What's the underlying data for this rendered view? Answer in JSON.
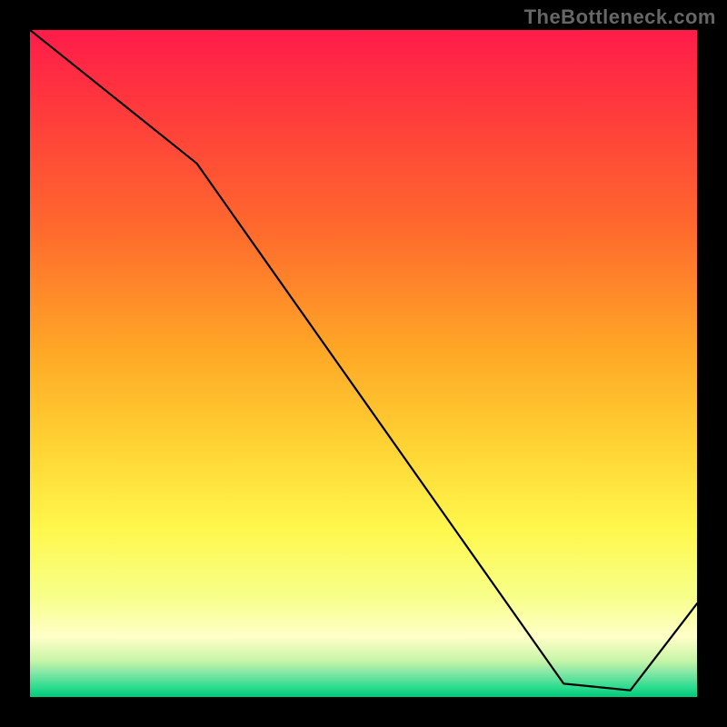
{
  "watermark": "TheBottleneck.com",
  "floor_label": "",
  "colors": {
    "frame": "#000000",
    "line": "#000000",
    "label": "#D22B2B",
    "watermark": "#666666"
  },
  "chart_data": {
    "type": "line",
    "title": "",
    "xlabel": "",
    "ylabel": "",
    "xlim": [
      0,
      100
    ],
    "ylim": [
      0,
      100
    ],
    "background_gradient_stops": [
      {
        "pos": 0.0,
        "color": "#FF1C4A"
      },
      {
        "pos": 0.12,
        "color": "#FF3A3C"
      },
      {
        "pos": 0.3,
        "color": "#FF6A2D"
      },
      {
        "pos": 0.48,
        "color": "#FFA726"
      },
      {
        "pos": 0.62,
        "color": "#FFD233"
      },
      {
        "pos": 0.75,
        "color": "#FFF84D"
      },
      {
        "pos": 0.85,
        "color": "#F7FF8A"
      },
      {
        "pos": 0.91,
        "color": "#FFFFC8"
      },
      {
        "pos": 0.945,
        "color": "#C8F5A8"
      },
      {
        "pos": 0.965,
        "color": "#7FE6A5"
      },
      {
        "pos": 0.985,
        "color": "#2DDC8F"
      },
      {
        "pos": 1.0,
        "color": "#00C97A"
      }
    ],
    "series": [
      {
        "name": "bottleneck-curve",
        "x": [
          0,
          25,
          80,
          90,
          100
        ],
        "y": [
          100,
          80,
          2,
          1,
          14
        ]
      }
    ],
    "annotations": [
      {
        "name": "floor-label",
        "x": 85,
        "y": 2,
        "text": ""
      }
    ]
  }
}
